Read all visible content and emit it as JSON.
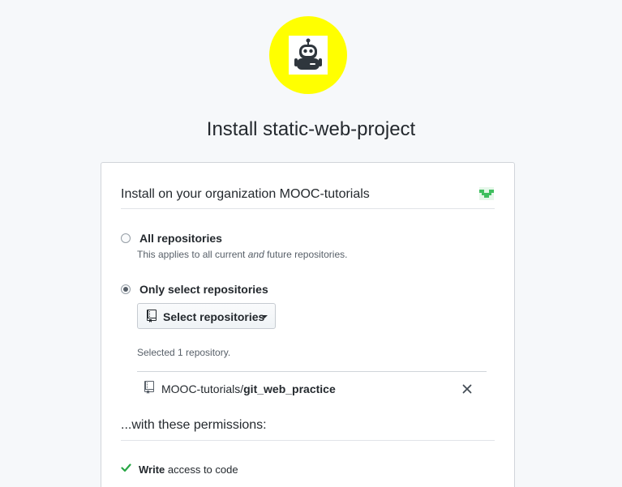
{
  "app": {
    "title": "Install static-web-project",
    "logo_bg_color": "#ffff00",
    "logo_icon": "robot-icon"
  },
  "install": {
    "header": "Install on your organization MOOC-tutorials",
    "org_avatar_icon": "identicon-avatar"
  },
  "options": {
    "all": {
      "label": "All repositories",
      "note_before": "This applies to all current ",
      "note_em": "and",
      "note_after": " future repositories.",
      "selected": false
    },
    "select": {
      "label": "Only select repositories",
      "selected": true
    }
  },
  "select_button": {
    "label": "Select repositories",
    "icon": "repo-icon"
  },
  "selected_count": "Selected 1 repository.",
  "repositories": [
    {
      "owner": "MOOC-tutorials/",
      "name": "git_web_practice",
      "icon": "repo-icon",
      "remove_icon": "x-icon"
    }
  ],
  "permissions": {
    "heading": "...with these permissions:",
    "items": [
      {
        "strong": "Write",
        "text": " access to code",
        "icon": "check-icon",
        "icon_color": "#28a745"
      }
    ]
  }
}
